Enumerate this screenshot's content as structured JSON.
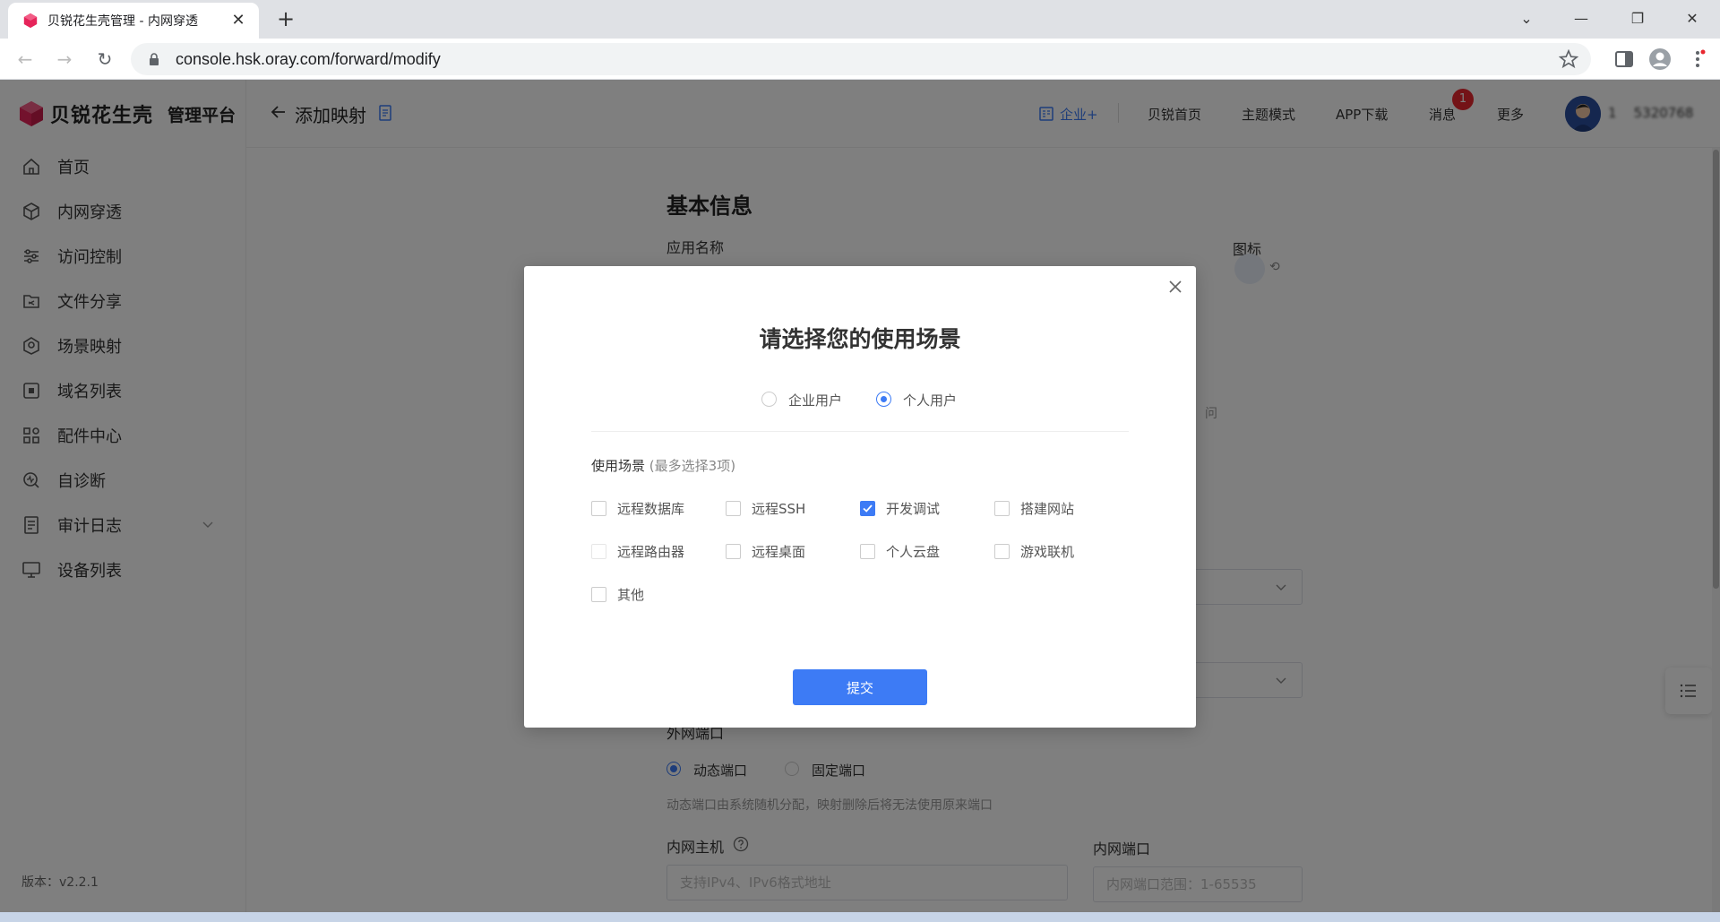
{
  "browser": {
    "tab_title": "贝锐花生壳管理 - 内网穿透",
    "url": "console.hsk.oray.com/forward/modify"
  },
  "sidebar": {
    "brand_name": "贝锐花生壳",
    "brand_sub": "管理平台",
    "items": [
      {
        "label": "首页",
        "icon": "home-icon"
      },
      {
        "label": "内网穿透",
        "icon": "cube-icon"
      },
      {
        "label": "访问控制",
        "icon": "sliders-icon"
      },
      {
        "label": "文件分享",
        "icon": "folder-share-icon"
      },
      {
        "label": "场景映射",
        "icon": "scene-icon"
      },
      {
        "label": "域名列表",
        "icon": "domain-icon"
      },
      {
        "label": "配件中心",
        "icon": "grid-icon"
      },
      {
        "label": "自诊断",
        "icon": "diagnose-icon"
      },
      {
        "label": "审计日志",
        "icon": "log-icon"
      },
      {
        "label": "设备列表",
        "icon": "monitor-icon"
      }
    ],
    "version": "版本：v2.2.1"
  },
  "header": {
    "title": "添加映射",
    "enterprise": "企业+",
    "home": "贝锐首页",
    "theme": "主题模式",
    "app_download": "APP下载",
    "messages": "消息",
    "message_count": "1",
    "more": "更多",
    "username": "1    5320768"
  },
  "form": {
    "section_title": "基本信息",
    "app_name_label": "应用名称",
    "icon_label": "图标",
    "partial_hint": "问",
    "external_port_label": "外网端口",
    "port_dynamic": "动态端口",
    "port_fixed": "固定端口",
    "port_hint": "动态端口由系统随机分配，映射删除后将无法使用原来端口",
    "internal_host_label": "内网主机",
    "internal_host_placeholder": "支持IPv4、IPv6格式地址",
    "internal_port_label": "内网端口",
    "internal_port_placeholder": "内网端口范围：1-65535"
  },
  "modal": {
    "title": "请选择您的使用场景",
    "user_types": [
      {
        "label": "企业用户",
        "selected": false
      },
      {
        "label": "个人用户",
        "selected": true
      }
    ],
    "scene_label": "使用场景",
    "scene_note": "(最多选择3项)",
    "scenes": [
      {
        "label": "远程数据库",
        "checked": false
      },
      {
        "label": "远程SSH",
        "checked": false
      },
      {
        "label": "开发调试",
        "checked": true
      },
      {
        "label": "搭建网站",
        "checked": false
      },
      {
        "label": "远程路由器",
        "checked": false
      },
      {
        "label": "远程桌面",
        "checked": false
      },
      {
        "label": "个人云盘",
        "checked": false
      },
      {
        "label": "游戏联机",
        "checked": false
      },
      {
        "label": "其他",
        "checked": false
      }
    ],
    "submit": "提交"
  },
  "colors": {
    "accent": "#3d7bf5",
    "brand": "#e6245a",
    "badge": "#e8262e"
  }
}
